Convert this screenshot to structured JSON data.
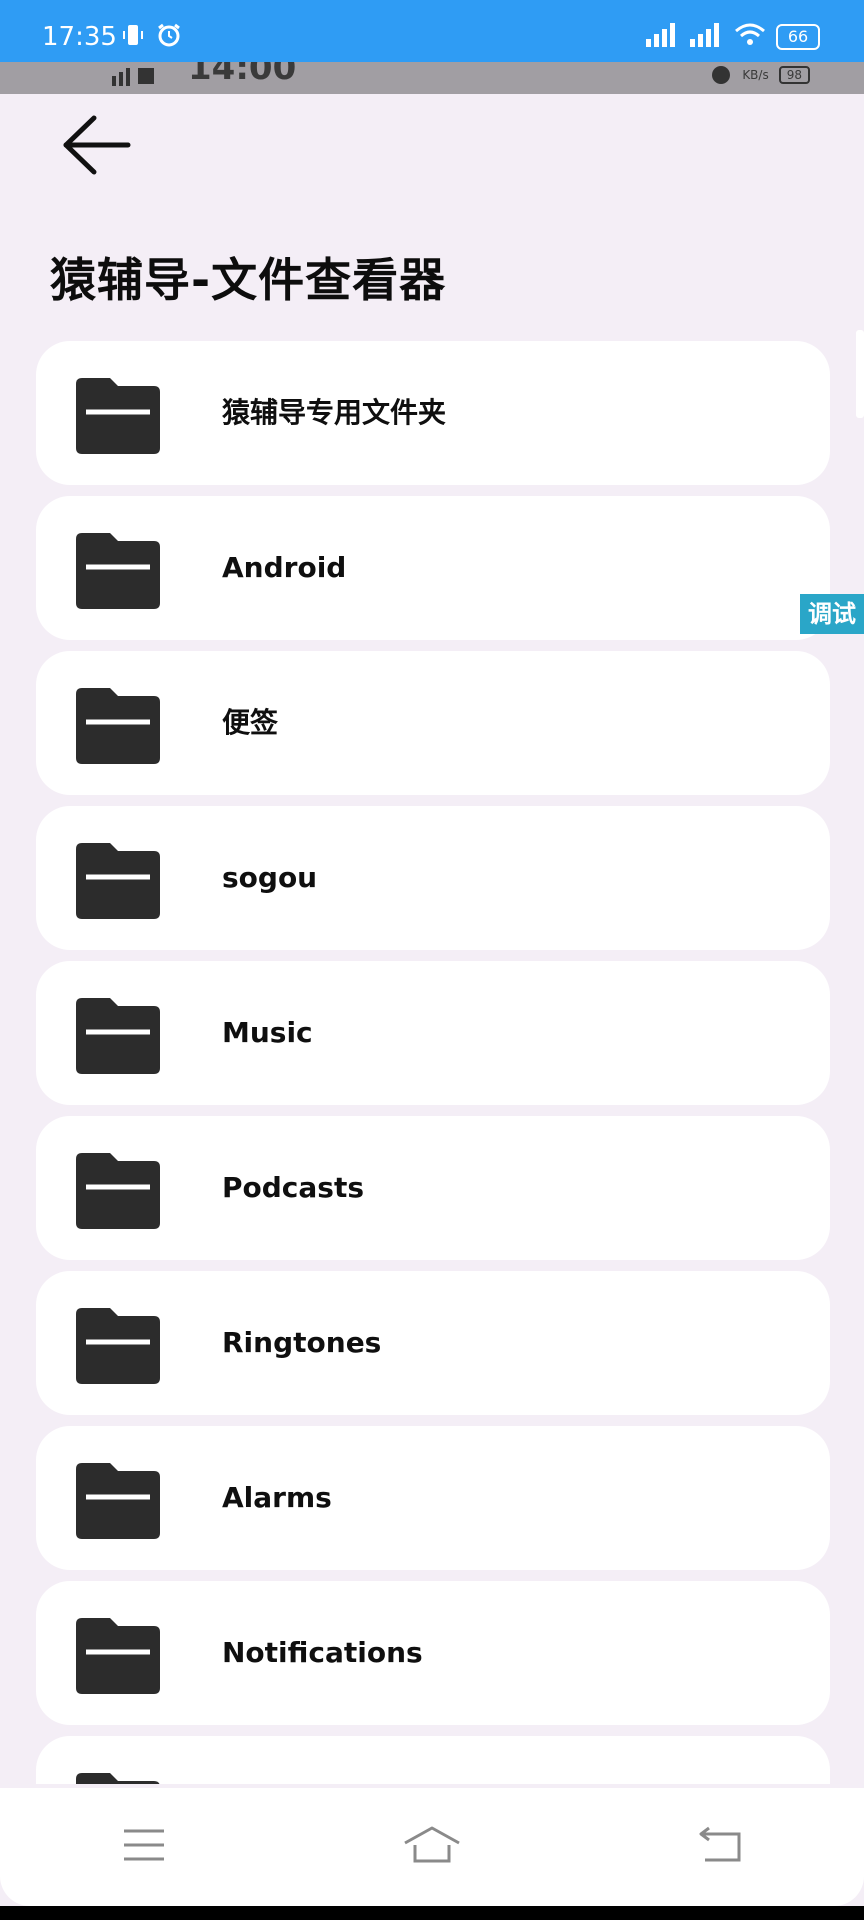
{
  "status_bar": {
    "time": "17:35",
    "battery": "66",
    "accent_color": "#2f9cf4"
  },
  "ghost_status": {
    "time": "14:00",
    "speed_unit": "KB/s",
    "battery": "98"
  },
  "header": {
    "back_icon": "arrow-left-icon",
    "title": "猿辅导-文件查看器"
  },
  "folders": [
    {
      "name": "猿辅导专用文件夹"
    },
    {
      "name": "Android"
    },
    {
      "name": "便签"
    },
    {
      "name": "sogou"
    },
    {
      "name": "Music"
    },
    {
      "name": "Podcasts"
    },
    {
      "name": "Ringtones"
    },
    {
      "name": "Alarms"
    },
    {
      "name": "Notifications"
    }
  ],
  "debug_tab": {
    "label": "调试",
    "color": "#2aa6c8"
  },
  "nav_bar": {
    "menu_icon": "menu-icon",
    "home_icon": "home-icon",
    "back_icon": "back-return-icon"
  }
}
